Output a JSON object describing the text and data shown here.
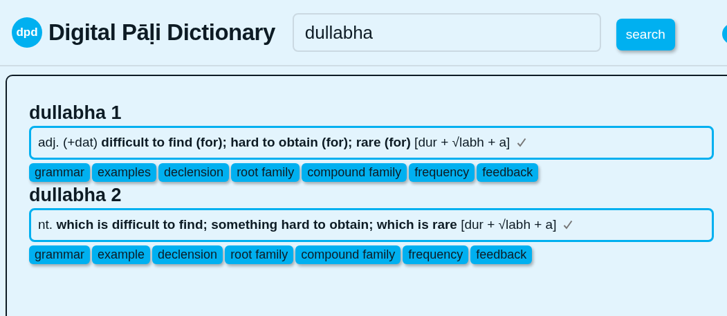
{
  "header": {
    "logo": "dpd",
    "title": "Digital Pāḷi Dictionary",
    "search": {
      "value": "dullabha"
    },
    "search_button": "search"
  },
  "entries": [
    {
      "headword": "dullabha 1",
      "summary": "adj. (+dat) **difficult to find (for); hard to obtain (for); rare (for)** [dur + √labh + a]",
      "verified": true,
      "buttons": [
        "grammar",
        "examples",
        "declension",
        "root family",
        "compound family",
        "frequency",
        "feedback"
      ]
    },
    {
      "headword": "dullabha 2",
      "summary": "nt. **which is difficult to find; something hard to obtain; which is rare** [dur + √labh + a]",
      "verified": true,
      "buttons": [
        "grammar",
        "example",
        "declension",
        "root family",
        "compound family",
        "frequency",
        "feedback"
      ]
    }
  ]
}
